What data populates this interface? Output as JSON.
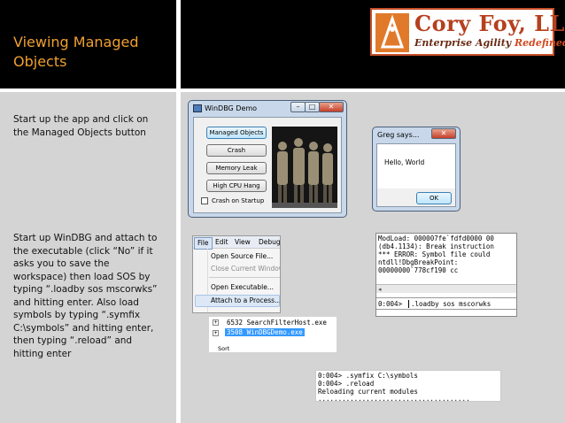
{
  "slide": {
    "title_line1": "Viewing Managed",
    "title_line2": "Objects",
    "step1": [
      "Start up the app and click on",
      "the Managed Objects button"
    ],
    "step2": [
      "Start up WinDBG and attach to",
      "the executable (click “No” if it",
      "asks you to save the",
      "workspace) then load SOS by",
      "typing “.loadby sos mscorwks”",
      "and hitting enter. Also load",
      "symbols by typing “.symfix",
      "C:\\symbols” and hitting enter,",
      "then typing “.reload” and",
      "hitting enter"
    ]
  },
  "logo": {
    "name": "Cory Foy, LLC",
    "tagline_part1": "Enterprise Agility ",
    "tagline_part2": "Redefined"
  },
  "demo_window": {
    "title": "WinDBG Demo",
    "buttons": [
      "Managed Objects",
      "Crash",
      "Memory Leak",
      "High CPU Hang"
    ],
    "checkbox_label": "Crash on Startup"
  },
  "message_box": {
    "title": "Greg says...",
    "message": "Hello, World",
    "ok_label": "OK"
  },
  "windbg_menu": {
    "menubar": [
      "File",
      "Edit",
      "View",
      "Debug"
    ],
    "items": [
      "Open Source File...",
      "Close Current Window",
      "Open Executable...",
      "Attach to a Process..."
    ]
  },
  "process_list": {
    "rows": [
      "6532 SearchFilterHost.exe",
      "3508 WinDBGDemo.exe"
    ],
    "footer": "Sort"
  },
  "output_console": {
    "lines": [
      "ModLoad: 000007fe`fdfd0000 00",
      "(db4.1134): Break instruction",
      "*** ERROR: Symbol file could",
      "ntdll!DbgBreakPoint:",
      "00000000`778cf190 cc"
    ],
    "prompt": "0:004>",
    "command": ".loadby sos mscorwks"
  },
  "reload_console": {
    "lines": [
      "0:004> .symfix C:\\symbols",
      "0:004> .reload",
      "Reloading current modules",
      "......................................"
    ]
  },
  "colors": {
    "title_orange": "#f0a030",
    "slide_bg": "#d4d4d4",
    "selection_blue": "#3399ff"
  }
}
